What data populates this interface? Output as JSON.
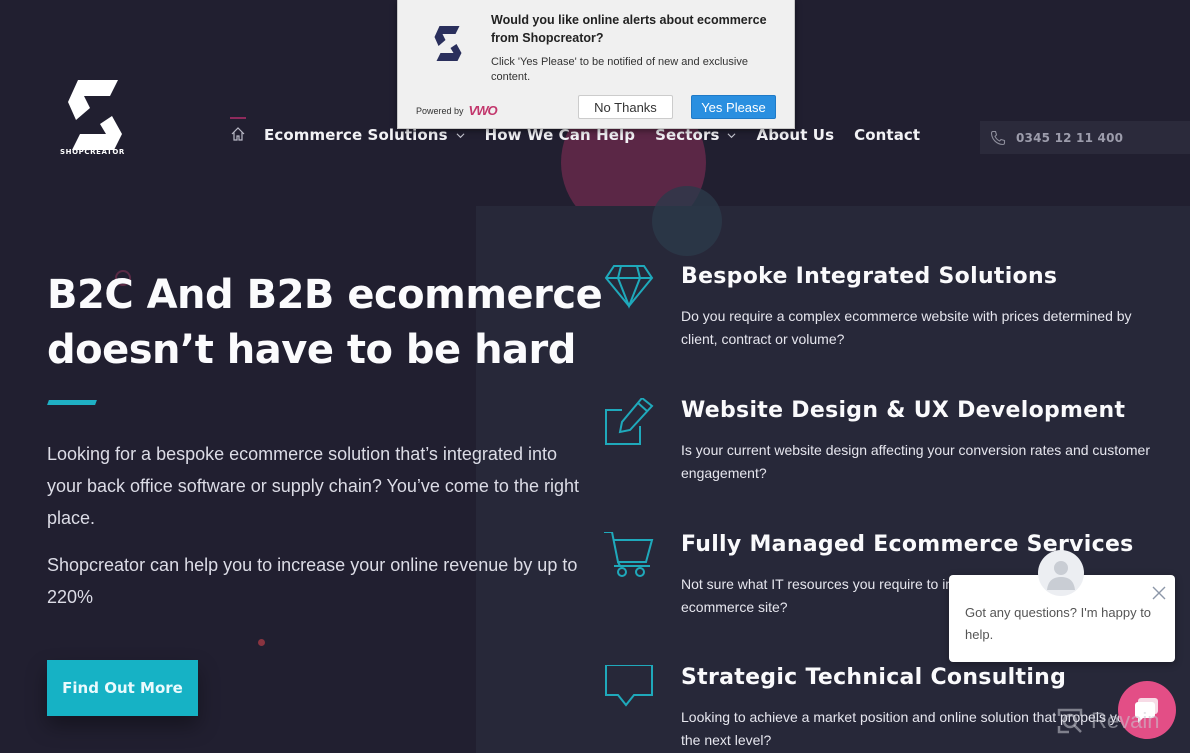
{
  "brand": {
    "name": "SHOPCREATOR"
  },
  "nav": {
    "items": [
      {
        "label": "Ecommerce Solutions",
        "dropdown": true
      },
      {
        "label": "How We Can Help",
        "dropdown": false
      },
      {
        "label": "Sectors",
        "dropdown": true
      },
      {
        "label": "About Us",
        "dropdown": false
      },
      {
        "label": "Contact",
        "dropdown": false
      }
    ],
    "home_icon": "home-icon",
    "phone": "0345 12 11 400",
    "phone_icon": "phone-icon"
  },
  "hero": {
    "title_line1": "B2C And B2B ecommerce",
    "title_line2": "doesn’t have to be hard",
    "paragraph1": "Looking for a bespoke ecommerce solution that’s integrated into your back office software or supply chain? You’ve come to the right place.",
    "paragraph2": "Shopcreator can help you to increase your online revenue by up to 220%",
    "cta_label": "Find Out More"
  },
  "services": [
    {
      "icon": "diamond-icon",
      "title": "Bespoke Integrated Solutions",
      "description": "Do you require a complex ecommerce website with prices determined by client, contract or volume?"
    },
    {
      "icon": "edit-icon",
      "title": "Website Design & UX Development",
      "description": "Is your current website design affecting your conversion rates and customer engagement?"
    },
    {
      "icon": "cart-icon",
      "title": "Fully Managed Ecommerce Services",
      "description": "Not sure what IT resources you require to implement a successful ecommerce site?"
    },
    {
      "icon": "speech-bubble-icon",
      "title": "Strategic Technical Consulting",
      "description": "Looking to achieve a market position and online solution that propels you to the next level?"
    }
  ],
  "notification_popup": {
    "title": "Would you like online alerts about ecommerce from Shopcreator?",
    "body": "Click 'Yes Please' to be notified of new and exclusive content.",
    "powered_by": "Powered by",
    "powered_brand": "VWO",
    "no_label": "No Thanks",
    "yes_label": "Yes Please"
  },
  "chat_widget": {
    "message": "Got any questions? I'm happy to help."
  },
  "watermark": {
    "text": "Revain"
  },
  "colors": {
    "background": "#211f30",
    "panel": "#272839",
    "accent": "#16b2c5",
    "pink": "#e34e86",
    "vwo_yes": "#2a8fe0"
  }
}
